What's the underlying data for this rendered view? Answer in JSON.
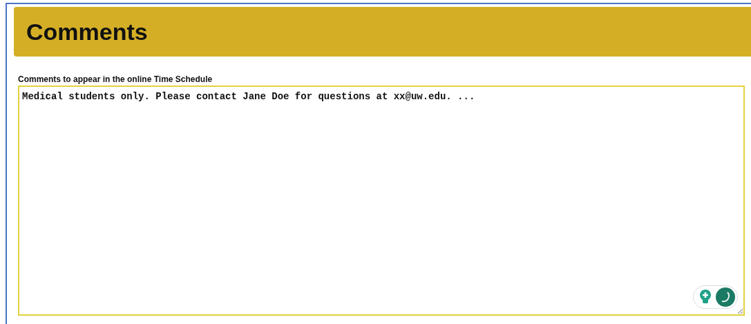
{
  "section": {
    "title": "Comments"
  },
  "comments_field": {
    "label": "Comments to appear in the online Time Schedule",
    "value": "Medical students only. Please contact Jane Doe for questions at xx@uw.edu. ..."
  }
}
